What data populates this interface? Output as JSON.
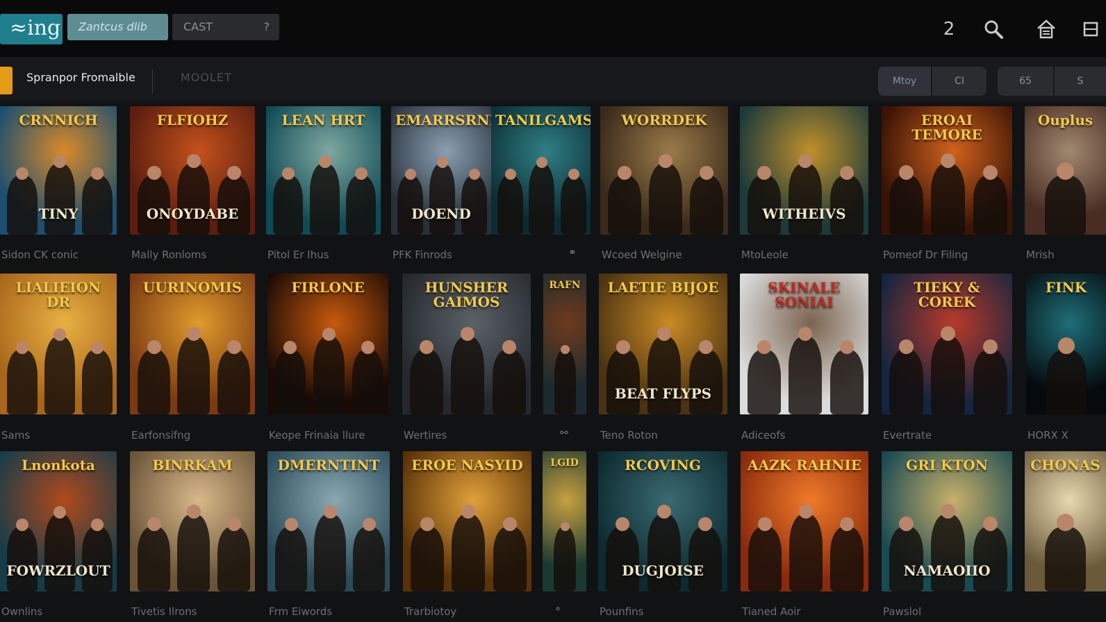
{
  "header": {
    "logo": "≈ing",
    "genre_label": "Zantcus dlib",
    "cast_label": "CAST",
    "cast_caret": "?",
    "badge": "2"
  },
  "filters": {
    "section_title": "Spranpor Fromalble",
    "section_alt": "MOOLET",
    "toggles": [
      "Mtoy",
      "CI",
      "65",
      "S"
    ]
  },
  "rows": [
    {
      "posters": [
        {
          "top": "CRNNICH",
          "bottom": "TINY",
          "bg": [
            "#1d4f6e",
            "#d88a2a"
          ],
          "caption": "Sidon CK conic"
        },
        {
          "top": "FLFIOHZ",
          "bottom": "ONOYDABE",
          "bg": [
            "#5a1d0f",
            "#c4521c"
          ],
          "caption": "Mally Ronloms"
        },
        {
          "top": "LEAN HRT",
          "bottom": "",
          "bg": [
            "#0f4a55",
            "#7fa8a0"
          ],
          "caption": "Pitol Er Ihus"
        },
        {
          "top": "EMARRSRNIFES",
          "bottom": "DOEND",
          "bg": [
            "#28303a",
            "#8aa0b2"
          ],
          "caption": "PFK Finrods"
        },
        {
          "top": "TANILGAMS",
          "bottom": "",
          "bg": [
            "#0c2c33",
            "#2f7f84"
          ],
          "caption": ""
        },
        {
          "top": "WORRDEK",
          "bottom": "",
          "bg": [
            "#3a2a1a",
            "#9a7a4a"
          ],
          "caption": "Wcoed Welgine"
        },
        {
          "top": "",
          "bottom": "WITHEIVS",
          "bg": [
            "#1c3a3a",
            "#c0902a"
          ],
          "caption": "MtoLeole"
        },
        {
          "top": "EROAI TEMORE",
          "bottom": "",
          "bg": [
            "#3a1306",
            "#d0621c"
          ],
          "caption": "Pomeof Dr Filing"
        },
        {
          "top": "Ouplus",
          "bottom": "",
          "bg": [
            "#4a2d22",
            "#a08870"
          ],
          "caption": "Mrish"
        }
      ],
      "extra_icon": "⚭"
    },
    {
      "posters": [
        {
          "top": "LIALIEION DR",
          "bottom": "",
          "bg": [
            "#a8661a",
            "#e8b043"
          ],
          "caption": "Sams"
        },
        {
          "top": "UURINOMIS",
          "bottom": "",
          "bg": [
            "#7a3a12",
            "#e09a2c"
          ],
          "caption": "Earfonsifng"
        },
        {
          "top": "FIRLONE",
          "bottom": "",
          "bg": [
            "#1a0a05",
            "#c85a0c"
          ],
          "caption": "Keope Frinaia llure"
        },
        {
          "top": "HUNSHER GAIMOS",
          "bottom": "",
          "bg": [
            "#24282c",
            "#5a6268"
          ],
          "caption": "Wertires"
        },
        {
          "top": "RAFN",
          "bottom": "",
          "bg": [
            "#1a2a30",
            "#6e3a1c"
          ],
          "caption": ""
        },
        {
          "top": "LAETIE BIJOE",
          "bottom": "BEAT FLYPS",
          "bg": [
            "#4a3212",
            "#c98a24"
          ],
          "caption": "Teno Roton"
        },
        {
          "top": "SKINALE SONIAI",
          "bottom": "",
          "bg": [
            "#dcdcdc",
            "#7a6450"
          ],
          "caption": "Adiceofs"
        },
        {
          "top": "TIEKY & COREK",
          "bottom": "",
          "bg": [
            "#13253f",
            "#b83a2a"
          ],
          "caption": "Evertrate"
        },
        {
          "top": "FINK",
          "bottom": "",
          "bg": [
            "#050a0e",
            "#1e6e78"
          ],
          "caption": "HORX X"
        }
      ],
      "extra_icon": "⚯"
    },
    {
      "posters": [
        {
          "top": "Lnonkota",
          "bottom": "FOWRZLOUT",
          "bg": [
            "#163c48",
            "#b04a1c"
          ],
          "caption": "Ownlins"
        },
        {
          "top": "BINRKAM",
          "bottom": "",
          "bg": [
            "#6a5438",
            "#d8b88a"
          ],
          "caption": "Tivetis Ilrons"
        },
        {
          "top": "DMERNTINT",
          "bottom": "",
          "bg": [
            "#2a4a58",
            "#8aa8b0"
          ],
          "caption": "Frm Eiwords"
        },
        {
          "top": "EROE NASYID",
          "bottom": "",
          "bg": [
            "#5a3208",
            "#e0a03a"
          ],
          "caption": "Trarbiotoy"
        },
        {
          "top": "LGID",
          "bottom": "",
          "bg": [
            "#1a3a30",
            "#c8a040"
          ],
          "caption": ""
        },
        {
          "top": "RCOVING",
          "bottom": "DUGJOISE",
          "bg": [
            "#0c2a30",
            "#3a6a70"
          ],
          "caption": "Pounfins"
        },
        {
          "top": "AAZK RAHNIE",
          "bottom": "",
          "bg": [
            "#8a2a0c",
            "#f07a2a"
          ],
          "caption": "Tianed Aoir"
        },
        {
          "top": "GRI KTON",
          "bottom": "NAMAOIIO",
          "bg": [
            "#1a4a52",
            "#c8b06a"
          ],
          "caption": "Pawslol"
        },
        {
          "top": "CHONAS",
          "bottom": "",
          "bg": [
            "#6a5a3a",
            "#e8d8b0"
          ],
          "caption": ""
        }
      ],
      "extra_icon": "⚬"
    }
  ]
}
